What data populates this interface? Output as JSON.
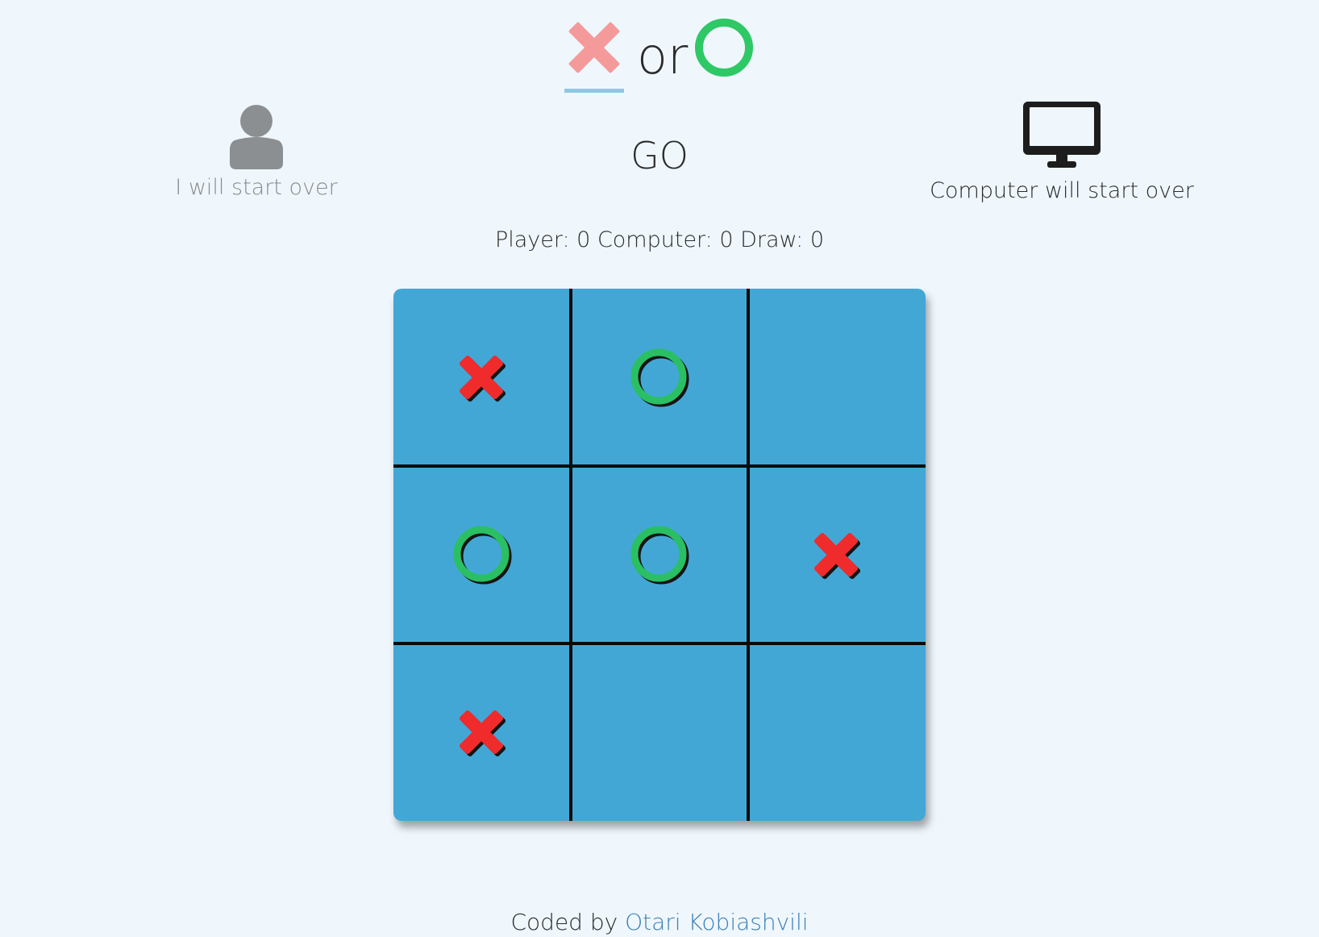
{
  "header": {
    "x_option_icon": "cross-icon",
    "or_label": "or",
    "o_option_icon": "circle-icon",
    "selected": "X"
  },
  "starters": {
    "player": {
      "icon": "user-icon",
      "label": "I will start over"
    },
    "go_label": "GO",
    "computer": {
      "icon": "desktop-icon",
      "label": "Computer will start over"
    }
  },
  "score": {
    "text": "Player: 0 Computer: 0 Draw: 0",
    "player": 0,
    "computer": 0,
    "draw": 0
  },
  "board": {
    "cells": [
      "X",
      "O",
      "",
      "O",
      "O",
      "X",
      "X",
      "",
      ""
    ]
  },
  "footer": {
    "prefix": "Coded by",
    "author": "Otari Kobiashvili"
  },
  "colors": {
    "background": "#eff7fd",
    "board": "#43a7d6",
    "x_mark": "#f02b2b",
    "o_mark": "#2abf62",
    "x_option": "#f59a9a",
    "o_option": "#2ec866",
    "selected_underline": "#8cc9e3",
    "link": "#3a7fb7"
  }
}
